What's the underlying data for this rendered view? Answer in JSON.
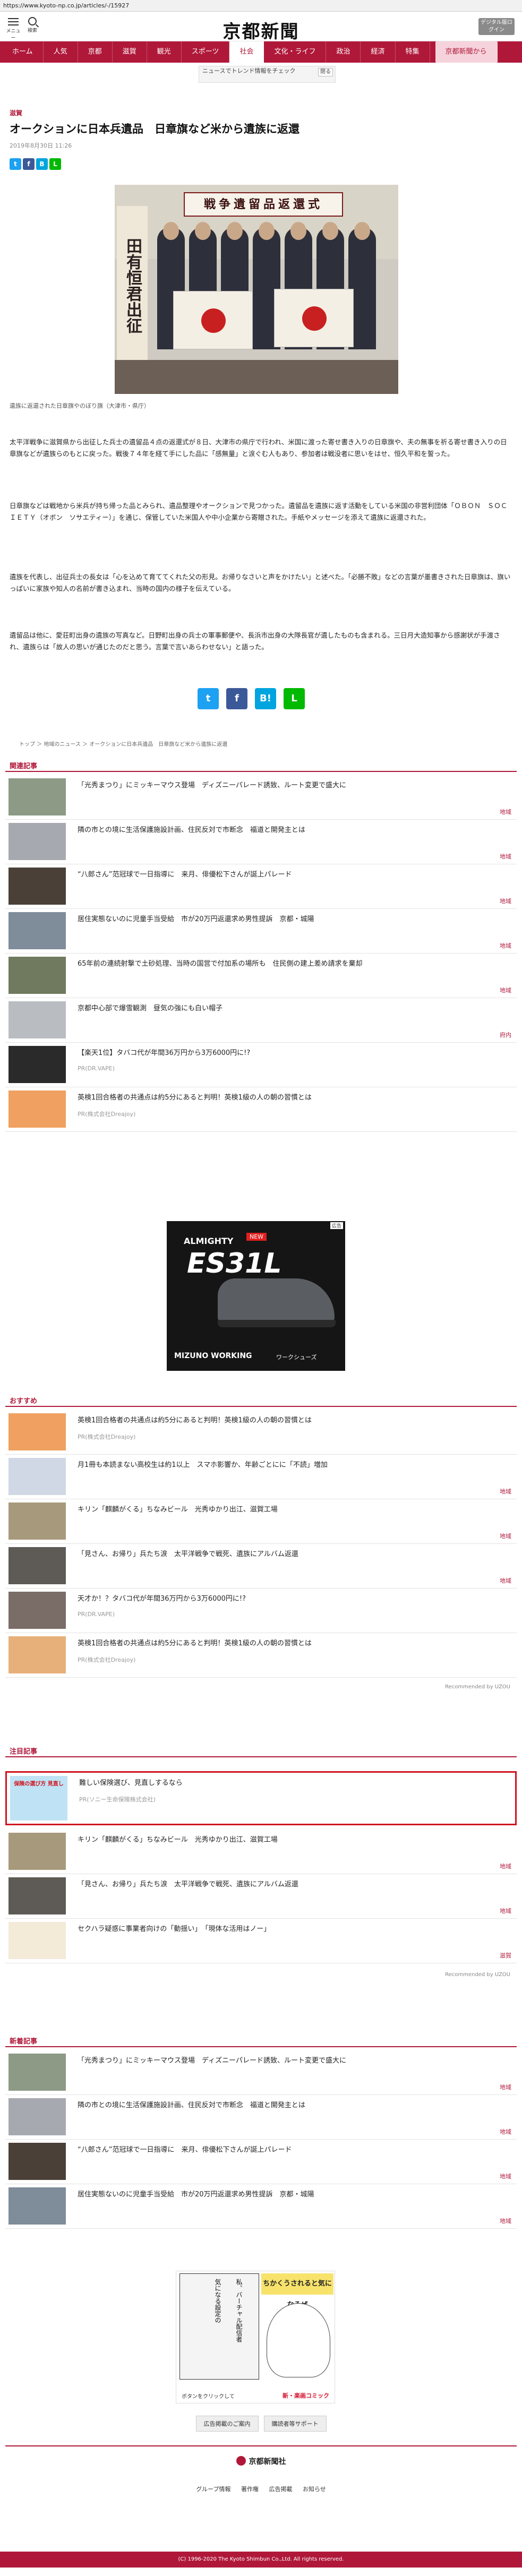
{
  "url": "https://www.kyoto-np.co.jp/articles/-/15927",
  "header": {
    "menu_label": "メニュー",
    "search_label": "検索",
    "logo": "京都新聞",
    "digital_btn": "デジタル版ログイン"
  },
  "nav": [
    "ホーム",
    "人気",
    "京都",
    "滋賀",
    "観光",
    "スポーツ",
    "社会",
    "文化・ライフ",
    "政治",
    "経済",
    "特集",
    "京都新聞から"
  ],
  "subbar": {
    "ad_text": "ニュースでトレンド情報をチェック",
    "ad_close": "閉る"
  },
  "article": {
    "category": "滋賀",
    "title": "オークションに日本兵遺品　日章旗など米から遺族に返還",
    "date": "2019年8月30日 11:26",
    "photo_banner": "戦争遺留品返還式",
    "photo_scroll": "田有恒君出征",
    "caption": "遺族に返還された日章旗やのぼり旗（大津市・県庁）",
    "paragraphs": [
      "太平洋戦争に滋賀県から出征した兵士の遺留品４点の返還式が８日、大津市の県庁で行われ、米国に渡った寄せ書き入りの日章旗や、夫の無事を祈る寄せ書き入りの日章旗などが遺族らのもとに戻った。戦後７４年を経て手にした品に「感無量」と涙ぐむ人もあり、参加者は戦没者に思いをはせ、恒久平和を誓った。",
      "日章旗などは戦地から米兵が持ち帰った品とみられ、遺品整理やオークションで見つかった。遺留品を遺族に返す活動をしている米国の非営利団体「ＯＢＯＮ　ＳＯＣＩＥＴＹ（オボン　ソサエティー）」を通じ、保管していた米国人や中小企業から寄贈された。手紙やメッセージを添えて遺族に返還された。",
      "遺族を代表し、出征兵士の長女は「心を込めて育ててくれた父の形見。お帰りなさいと声をかけたい」と述べた。「必勝不敗」などの言葉が墨書きされた日章旗は、旗いっぱいに家族や知人の名前が書き込まれ、当時の国内の様子を伝えている。",
      "遺留品は他に、愛荘町出身の遺族の写真など。日野町出身の兵士の軍事郵便や、長浜市出身の大隊長官が遺したものも含まれる。三日月大造知事から感謝状が手渡され、遺族らは「故人の思いが通じたのだと思う。言葉で言いあらわせない」と語った。"
    ]
  },
  "breadcrumb": "トップ ＞ 地域のニュース ＞ オークションに日本兵遺品　日章旗など米から遺族に返還",
  "sections": {
    "related": "関連記事",
    "recommended": "おすすめ",
    "featured": "注目記事",
    "newest": "新着記事"
  },
  "related": [
    {
      "title": "「光秀まつり」にミッキーマウス登場　ディズニーパレード誘致、ルート変更で盛大に",
      "src": "地域"
    },
    {
      "title": "隣の市との境に生活保護施設計画、住民反対で市断念　福道と開発主とは",
      "src": "地域"
    },
    {
      "title": "“八郎さん”范冠球で一日指導に　来月、俳優松下さんが誕上パレード",
      "src": "地域"
    },
    {
      "title": "居住実態ないのに児童手当受給　市が20万円返還求め男性提訴　京都・城陽",
      "src": "地域"
    },
    {
      "title": "65年前の連続射撃で土砂処理、当時の国営で付加系の場所も　住民側の建上差め請求を棄却",
      "src": "地域"
    },
    {
      "title": "京都中心部で爆雪観測　昼気の強にも白い帽子",
      "src": "府内"
    },
    {
      "title": "【楽天1位】タバコ代が年間36万円から3万6000円に!?",
      "pr": "PR(DR.VAPE)"
    },
    {
      "title": "英検1回合格者の共通点は約5分にあると判明！英検1級の人の朝の習慣とは",
      "pr": "PR(株式会社Dreajoy)"
    }
  ],
  "ad_mid": {
    "label": "広告",
    "brand1": "ALMIGHTY",
    "brand2": "ES31L",
    "new": "NEW",
    "maker": "MIZUNO WORKING",
    "series": "ワークシューズ"
  },
  "recommended": [
    {
      "title": "英検1回合格者の共通点は約5分にあると判明！英検1級の人の朝の習慣とは",
      "pr": "PR(株式会社Dreajoy)"
    },
    {
      "title": "月1冊も本読まない高校生は約1以上　スマホ影響か、年齢ごとにに「不読」増加",
      "src": "地域"
    },
    {
      "title": "キリン「麒麟がくる」ちなみビール　光秀ゆかり出江、滋賀工場",
      "src": "地域"
    },
    {
      "title": "「見さん、お帰り」兵たち涙　太平洋戦争で戦死、遺族にアルバム返還",
      "src": "地域"
    },
    {
      "title": "天才か！？タバコ代が年間36万円から3万6000円に!?",
      "pr": "PR(DR.VAPE)"
    },
    {
      "title": "英検1回合格者の共通点は約5分にあると判明！英検1級の人の朝の習慣とは",
      "pr": "PR(株式会社Dreajoy)"
    }
  ],
  "powered_by": "Recommended by UZOU",
  "featured": [
    {
      "title": "難しい保険選び、見直しするなら",
      "pr": "PR(ソニー生命保険株式会社)",
      "thumb": "保険の選び方 見直し"
    },
    {
      "title": "キリン「麒麟がくる」ちなみビール　光秀ゆかり出江、滋賀工場",
      "src": "地域"
    },
    {
      "title": "「見さん、お帰り」兵たち涙　太平洋戦争で戦死、遺族にアルバム返還",
      "src": "地域"
    },
    {
      "title": "セクハラ疑惑に事業者向けの「動揺い」　「現体な活用はノー」",
      "src": "滋賀"
    }
  ],
  "newest": [
    {
      "title": "「光秀まつり」にミッキーマウス登場　ディズニーパレード誘致、ルート変更で盛大に",
      "src": "地域"
    },
    {
      "title": "隣の市との境に生活保護施設計画、住民反対で市断念　福道と開発主とは",
      "src": "地域"
    },
    {
      "title": "“八郎さん”范冠球で一日指導に　来月、俳優松下さんが誕上パレード",
      "src": "地域"
    },
    {
      "title": "居住実態ないのに児童手当受給　市が20万円返還求め男性提訴　京都・城陽",
      "src": "地域"
    }
  ],
  "bottom_ad": {
    "top_text": "ちかくうされると気になるぜ",
    "vtext1": "私、バーチャル配信者",
    "vtext2": "気になる設定の",
    "footer_left": "ボタンをクリックして",
    "footer_right": "新・楽画コミック"
  },
  "footer": {
    "btn1": "広告掲載のご案内",
    "btn2": "購読者等サポート",
    "company": "京都新聞社",
    "links": [
      "グループ情報",
      "著作権",
      "広告掲載",
      "お知らせ"
    ],
    "copyright": "(C) 1996-2020 The Kyoto Shimbun Co.,Ltd. All rights reserved."
  }
}
